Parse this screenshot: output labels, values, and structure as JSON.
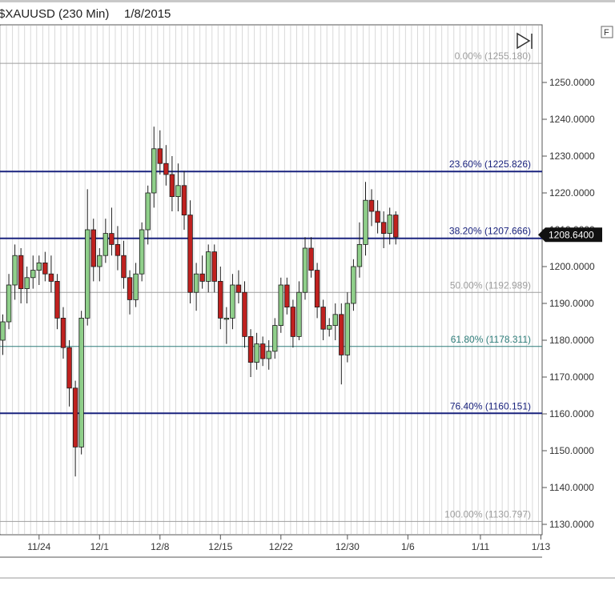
{
  "header": {
    "symbol": "$XAUUSD (230 Min)",
    "date": "1/8/2015",
    "corner_button": "F"
  },
  "colors": {
    "up_candle": "#8fcf8a",
    "down_candle": "#c0211f",
    "fib_strong": "#1a237e",
    "fib_mid": "#2e7d7a",
    "fib_faint": "#9e9e9e",
    "price_tag_bg": "#111111"
  },
  "chart_data": {
    "type": "candlestick",
    "title": "$XAUUSD (230 Min)  1/8/2015",
    "ylim": [
      1125,
      1265
    ],
    "y_ticks": [
      "1250.0000",
      "1240.0000",
      "1230.0000",
      "1220.0000",
      "1210.0000",
      "1200.0000",
      "1190.0000",
      "1180.0000",
      "1170.0000",
      "1160.0000",
      "1150.0000",
      "1140.0000",
      "1130.0000"
    ],
    "y_tick_values": [
      1250,
      1240,
      1230,
      1220,
      1210,
      1200,
      1190,
      1180,
      1170,
      1160,
      1150,
      1140,
      1130
    ],
    "x_ticks": [
      "11/24",
      "12/1",
      "12/8",
      "12/15",
      "12/22",
      "12/30",
      "1/6",
      "1/11",
      "1/13"
    ],
    "x_tick_index": [
      6,
      16,
      26,
      36,
      46,
      57,
      67,
      79,
      89
    ],
    "current_price": "1208.6400",
    "current_price_value": 1208.64,
    "fib_levels": [
      {
        "label": "0.00% (1255.180)",
        "value": 1255.18,
        "style": "faint"
      },
      {
        "label": "23.60% (1225.826)",
        "value": 1225.826,
        "style": "strong"
      },
      {
        "label": "38.20% (1207.666)",
        "value": 1207.666,
        "style": "strong"
      },
      {
        "label": "50.00% (1192.989)",
        "value": 1192.989,
        "style": "faint"
      },
      {
        "label": "61.80% (1178.311)",
        "value": 1178.311,
        "style": "mid"
      },
      {
        "label": "76.40% (1160.151)",
        "value": 1160.151,
        "style": "strong"
      },
      {
        "label": "100.00% (1130.797)",
        "value": 1130.797,
        "style": "faint"
      }
    ],
    "candles": [
      {
        "o": 1180,
        "h": 1187,
        "l": 1176,
        "c": 1185
      },
      {
        "o": 1185,
        "h": 1198,
        "l": 1183,
        "c": 1195
      },
      {
        "o": 1195,
        "h": 1206,
        "l": 1191,
        "c": 1203
      },
      {
        "o": 1203,
        "h": 1205,
        "l": 1190,
        "c": 1194
      },
      {
        "o": 1194,
        "h": 1200,
        "l": 1190,
        "c": 1197
      },
      {
        "o": 1197,
        "h": 1203,
        "l": 1194,
        "c": 1199
      },
      {
        "o": 1199,
        "h": 1203,
        "l": 1195,
        "c": 1201
      },
      {
        "o": 1201,
        "h": 1204,
        "l": 1196,
        "c": 1198
      },
      {
        "o": 1198,
        "h": 1203,
        "l": 1193,
        "c": 1196
      },
      {
        "o": 1196,
        "h": 1198,
        "l": 1183,
        "c": 1186
      },
      {
        "o": 1186,
        "h": 1189,
        "l": 1175,
        "c": 1178
      },
      {
        "o": 1178,
        "h": 1180,
        "l": 1162,
        "c": 1167
      },
      {
        "o": 1167,
        "h": 1169,
        "l": 1143,
        "c": 1151
      },
      {
        "o": 1151,
        "h": 1188,
        "l": 1149,
        "c": 1186
      },
      {
        "o": 1186,
        "h": 1221,
        "l": 1184,
        "c": 1210
      },
      {
        "o": 1210,
        "h": 1213,
        "l": 1196,
        "c": 1200
      },
      {
        "o": 1200,
        "h": 1205,
        "l": 1196,
        "c": 1203
      },
      {
        "o": 1203,
        "h": 1213,
        "l": 1201,
        "c": 1209
      },
      {
        "o": 1209,
        "h": 1216,
        "l": 1203,
        "c": 1206
      },
      {
        "o": 1206,
        "h": 1211,
        "l": 1199,
        "c": 1203
      },
      {
        "o": 1203,
        "h": 1207,
        "l": 1194,
        "c": 1197
      },
      {
        "o": 1197,
        "h": 1199,
        "l": 1187,
        "c": 1191
      },
      {
        "o": 1191,
        "h": 1201,
        "l": 1189,
        "c": 1198
      },
      {
        "o": 1198,
        "h": 1212,
        "l": 1196,
        "c": 1210
      },
      {
        "o": 1210,
        "h": 1222,
        "l": 1206,
        "c": 1220
      },
      {
        "o": 1220,
        "h": 1238,
        "l": 1216,
        "c": 1232
      },
      {
        "o": 1232,
        "h": 1237,
        "l": 1225,
        "c": 1228
      },
      {
        "o": 1228,
        "h": 1233,
        "l": 1222,
        "c": 1225
      },
      {
        "o": 1225,
        "h": 1230,
        "l": 1215,
        "c": 1219
      },
      {
        "o": 1219,
        "h": 1228,
        "l": 1215,
        "c": 1222
      },
      {
        "o": 1222,
        "h": 1226,
        "l": 1210,
        "c": 1214
      },
      {
        "o": 1214,
        "h": 1218,
        "l": 1190,
        "c": 1193
      },
      {
        "o": 1193,
        "h": 1201,
        "l": 1188,
        "c": 1198
      },
      {
        "o": 1198,
        "h": 1203,
        "l": 1194,
        "c": 1196
      },
      {
        "o": 1196,
        "h": 1206,
        "l": 1193,
        "c": 1204
      },
      {
        "o": 1204,
        "h": 1206,
        "l": 1193,
        "c": 1196
      },
      {
        "o": 1196,
        "h": 1200,
        "l": 1183,
        "c": 1186
      },
      {
        "o": 1186,
        "h": 1189,
        "l": 1179,
        "c": 1186
      },
      {
        "o": 1186,
        "h": 1198,
        "l": 1183,
        "c": 1195
      },
      {
        "o": 1195,
        "h": 1199,
        "l": 1190,
        "c": 1193
      },
      {
        "o": 1193,
        "h": 1196,
        "l": 1178,
        "c": 1181
      },
      {
        "o": 1181,
        "h": 1183,
        "l": 1170,
        "c": 1174
      },
      {
        "o": 1174,
        "h": 1182,
        "l": 1172,
        "c": 1179
      },
      {
        "o": 1179,
        "h": 1181,
        "l": 1173,
        "c": 1175
      },
      {
        "o": 1175,
        "h": 1180,
        "l": 1172,
        "c": 1177
      },
      {
        "o": 1177,
        "h": 1186,
        "l": 1175,
        "c": 1184
      },
      {
        "o": 1184,
        "h": 1197,
        "l": 1182,
        "c": 1195
      },
      {
        "o": 1195,
        "h": 1197,
        "l": 1187,
        "c": 1189
      },
      {
        "o": 1189,
        "h": 1191,
        "l": 1178,
        "c": 1181
      },
      {
        "o": 1181,
        "h": 1196,
        "l": 1180,
        "c": 1193
      },
      {
        "o": 1193,
        "h": 1208,
        "l": 1191,
        "c": 1205
      },
      {
        "o": 1205,
        "h": 1208,
        "l": 1197,
        "c": 1199
      },
      {
        "o": 1199,
        "h": 1201,
        "l": 1186,
        "c": 1189
      },
      {
        "o": 1189,
        "h": 1191,
        "l": 1180,
        "c": 1183
      },
      {
        "o": 1183,
        "h": 1186,
        "l": 1181,
        "c": 1184
      },
      {
        "o": 1184,
        "h": 1190,
        "l": 1180,
        "c": 1187
      },
      {
        "o": 1187,
        "h": 1190,
        "l": 1168,
        "c": 1176
      },
      {
        "o": 1176,
        "h": 1193,
        "l": 1174,
        "c": 1190
      },
      {
        "o": 1190,
        "h": 1202,
        "l": 1188,
        "c": 1200
      },
      {
        "o": 1200,
        "h": 1212,
        "l": 1197,
        "c": 1206
      },
      {
        "o": 1206,
        "h": 1223,
        "l": 1203,
        "c": 1218
      },
      {
        "o": 1218,
        "h": 1221,
        "l": 1211,
        "c": 1215
      },
      {
        "o": 1215,
        "h": 1218,
        "l": 1209,
        "c": 1212
      },
      {
        "o": 1212,
        "h": 1215,
        "l": 1205,
        "c": 1209
      },
      {
        "o": 1209,
        "h": 1216,
        "l": 1206,
        "c": 1214
      },
      {
        "o": 1214,
        "h": 1215,
        "l": 1206,
        "c": 1208
      }
    ]
  }
}
